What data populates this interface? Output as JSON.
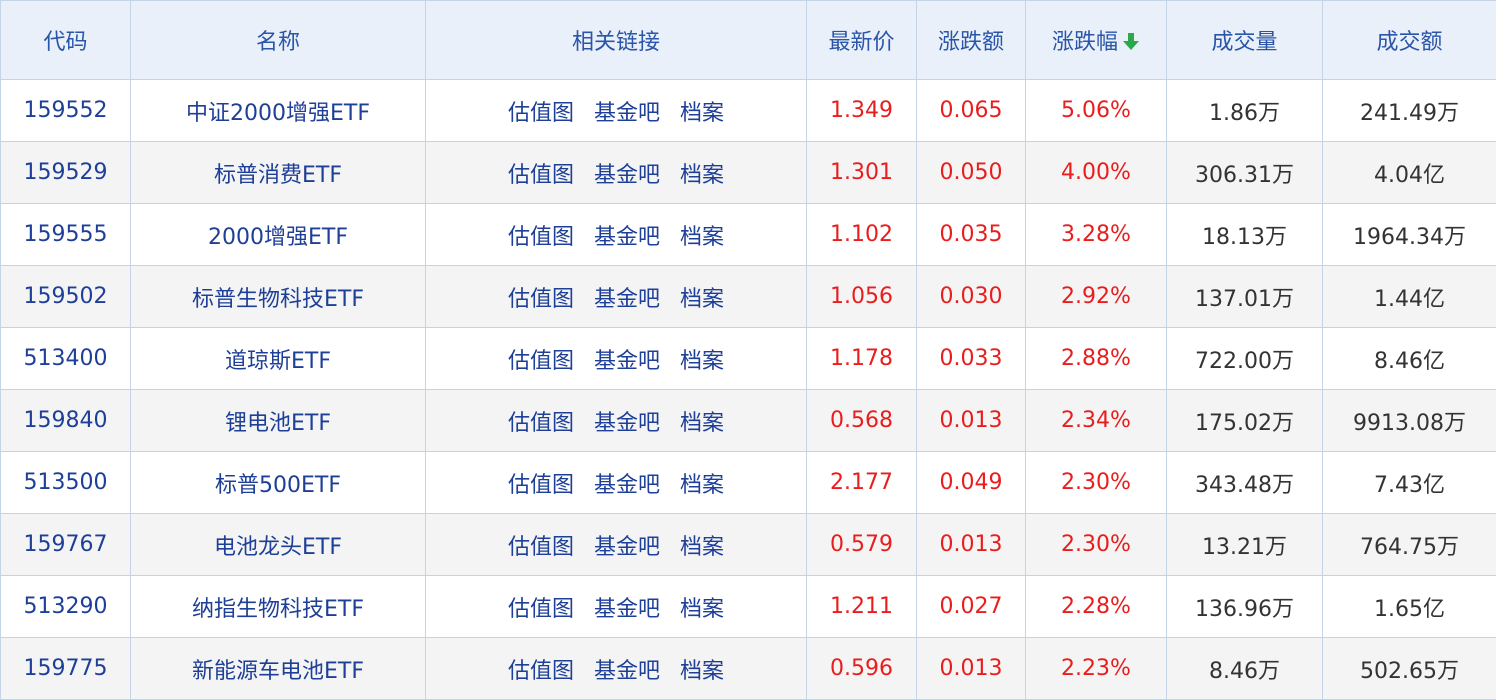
{
  "headers": {
    "code": "代码",
    "name": "名称",
    "links": "相关链接",
    "price": "最新价",
    "change": "涨跌额",
    "pct": "涨跌幅",
    "volume": "成交量",
    "amount": "成交额"
  },
  "sort": {
    "column": "pct",
    "direction": "descending",
    "icon": "arrow-down-icon",
    "color": "#2aa84a"
  },
  "colors": {
    "up": "#ea1d1d",
    "link": "#1e3f98",
    "header_bg": "#e9f0fa",
    "border": "#c4d4e6"
  },
  "link_labels": [
    "估值图",
    "基金吧",
    "档案"
  ],
  "rows": [
    {
      "code": "159552",
      "name": "中证2000增强ETF",
      "links": [
        "估值图",
        "基金吧",
        "档案"
      ],
      "price": "1.349",
      "change": "0.065",
      "pct": "5.06%",
      "volume": "1.86万",
      "amount": "241.49万"
    },
    {
      "code": "159529",
      "name": "标普消费ETF",
      "links": [
        "估值图",
        "基金吧",
        "档案"
      ],
      "price": "1.301",
      "change": "0.050",
      "pct": "4.00%",
      "volume": "306.31万",
      "amount": "4.04亿"
    },
    {
      "code": "159555",
      "name": "2000增强ETF",
      "links": [
        "估值图",
        "基金吧",
        "档案"
      ],
      "price": "1.102",
      "change": "0.035",
      "pct": "3.28%",
      "volume": "18.13万",
      "amount": "1964.34万"
    },
    {
      "code": "159502",
      "name": "标普生物科技ETF",
      "links": [
        "估值图",
        "基金吧",
        "档案"
      ],
      "price": "1.056",
      "change": "0.030",
      "pct": "2.92%",
      "volume": "137.01万",
      "amount": "1.44亿"
    },
    {
      "code": "513400",
      "name": "道琼斯ETF",
      "links": [
        "估值图",
        "基金吧",
        "档案"
      ],
      "price": "1.178",
      "change": "0.033",
      "pct": "2.88%",
      "volume": "722.00万",
      "amount": "8.46亿"
    },
    {
      "code": "159840",
      "name": "锂电池ETF",
      "links": [
        "估值图",
        "基金吧",
        "档案"
      ],
      "price": "0.568",
      "change": "0.013",
      "pct": "2.34%",
      "volume": "175.02万",
      "amount": "9913.08万"
    },
    {
      "code": "513500",
      "name": "标普500ETF",
      "links": [
        "估值图",
        "基金吧",
        "档案"
      ],
      "price": "2.177",
      "change": "0.049",
      "pct": "2.30%",
      "volume": "343.48万",
      "amount": "7.43亿"
    },
    {
      "code": "159767",
      "name": "电池龙头ETF",
      "links": [
        "估值图",
        "基金吧",
        "档案"
      ],
      "price": "0.579",
      "change": "0.013",
      "pct": "2.30%",
      "volume": "13.21万",
      "amount": "764.75万"
    },
    {
      "code": "513290",
      "name": "纳指生物科技ETF",
      "links": [
        "估值图",
        "基金吧",
        "档案"
      ],
      "price": "1.211",
      "change": "0.027",
      "pct": "2.28%",
      "volume": "136.96万",
      "amount": "1.65亿"
    },
    {
      "code": "159775",
      "name": "新能源车电池ETF",
      "links": [
        "估值图",
        "基金吧",
        "档案"
      ],
      "price": "0.596",
      "change": "0.013",
      "pct": "2.23%",
      "volume": "8.46万",
      "amount": "502.65万"
    }
  ]
}
